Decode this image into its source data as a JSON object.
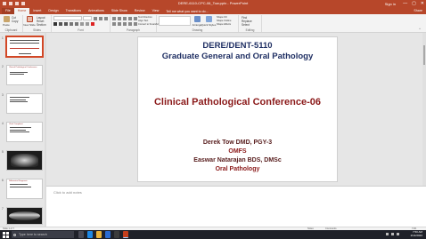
{
  "window": {
    "title": "DERE-6110-CPC-06_Tow.pptx - PowerPoint",
    "sign_in": "Sign in",
    "minimize": "—",
    "maximize": "▢",
    "close": "✕"
  },
  "ribbon_tabs": [
    {
      "label": "File"
    },
    {
      "label": "Home"
    },
    {
      "label": "Insert"
    },
    {
      "label": "Design"
    },
    {
      "label": "Transitions"
    },
    {
      "label": "Animations"
    },
    {
      "label": "Slide Show"
    },
    {
      "label": "Review"
    },
    {
      "label": "View"
    }
  ],
  "tell_me": "Tell me what you want to do...",
  "share": "Share",
  "ribbon": {
    "clipboard": {
      "paste": "Paste",
      "cut": "Cut",
      "copy": "Copy",
      "format_painter": "Format Painter",
      "label": "Clipboard"
    },
    "slides": {
      "new_slide": "New Slide",
      "layout": "Layout",
      "reset": "Reset",
      "section": "Section",
      "label": "Slides"
    },
    "font": {
      "label": "Font",
      "font_name": "",
      "font_size": ""
    },
    "paragraph": {
      "label": "Paragraph",
      "text_direction": "Text Direction",
      "align_text": "Align Text",
      "convert": "Convert to SmartArt"
    },
    "drawing": {
      "label": "Drawing",
      "arrange": "Arrange",
      "quick_styles": "Quick Styles",
      "shape_fill": "Shape Fill",
      "shape_outline": "Shape Outline",
      "shape_effects": "Shape Effects"
    },
    "editing": {
      "label": "Editing",
      "find": "Find",
      "replace": "Replace",
      "select": "Select"
    }
  },
  "thumbnails": [
    {
      "num": "1",
      "text": "DERE/DENT-5110 Graduate General and Oral Pathology"
    },
    {
      "num": "2",
      "text": "Clinical Pathological Conference"
    },
    {
      "num": "3",
      "text": ""
    },
    {
      "num": "4",
      "text": "Chief Complaint"
    },
    {
      "num": "5",
      "text": ""
    },
    {
      "num": "6",
      "text": "Differential Diagnosis"
    },
    {
      "num": "7",
      "text": ""
    }
  ],
  "slide": {
    "title_line1": "DERE/DENT-5110",
    "title_line2": "Graduate General and Oral Pathology",
    "conference": "Clinical Pathological Conference-06",
    "presenter1": "Derek Tow DMD, PGY-3",
    "dept1": "OMFS",
    "presenter2": "Easwar Natarajan BDS, DMSc",
    "dept2": "Oral Pathology"
  },
  "notes_placeholder": "Click to add notes",
  "status": {
    "slide_info": "Slide 1 of 7",
    "notes": "Notes",
    "comments": "Comments",
    "zoom": "71%"
  },
  "taskbar": {
    "search_placeholder": "Type here to search",
    "time": "7:50 AM",
    "date": "2/14/2022"
  },
  "colors": {
    "accent": "#b7472a",
    "slide_title": "#1f2f63",
    "slide_heading": "#8b1a1a"
  }
}
